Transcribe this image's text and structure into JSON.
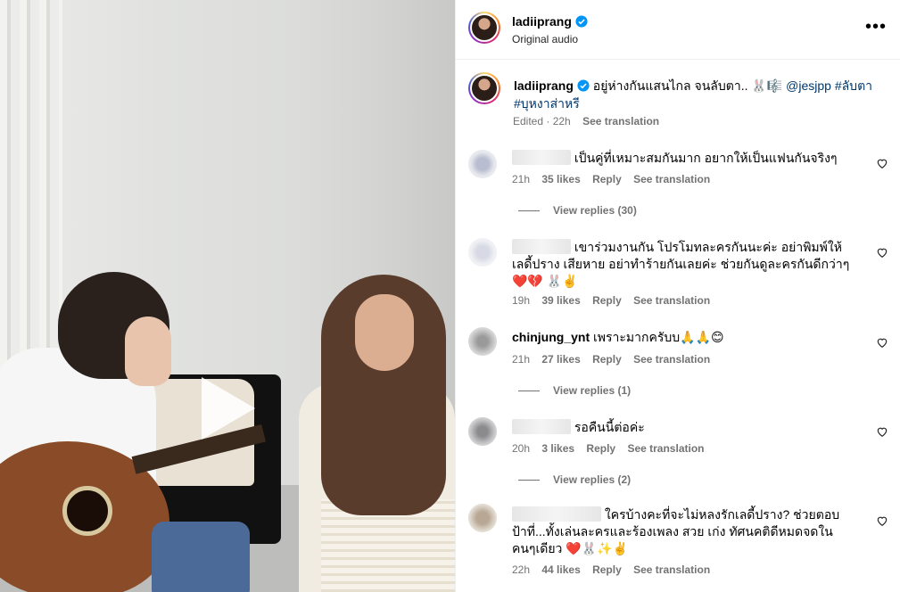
{
  "post": {
    "username": "ladiiprang",
    "audio": "Original audio"
  },
  "caption": {
    "username": "ladiiprang",
    "text": "อยู่ห่างกันแสนไกล จนลับตา.. 🐰🎼",
    "mention": "@jesjpp",
    "hashtag1": "#ลับตา",
    "hashtag2": "#บุหงาส่าหรี",
    "edited": "Edited",
    "time": "22h",
    "see_translation": "See translation"
  },
  "comments": [
    {
      "text": "เป็นคู่ที่เหมาะสมกันมาก อยากให้เป็นแฟนกันจริงๆ",
      "time": "21h",
      "likes": "35 likes",
      "reply": "Reply",
      "see_translation": "See translation",
      "view_replies": "View replies (30)"
    },
    {
      "text": "เขาร่วมงานกัน โปรโมทละครกันนะค่ะ อย่าพิมพ์ให้เลดี้ปราง เสียหาย อย่าทำร้ายกันเลยค่ะ ช่วยกันดูละครกันดีกว่าๆ ❤️💔 🐰✌️",
      "time": "19h",
      "likes": "39 likes",
      "reply": "Reply",
      "see_translation": "See translation"
    },
    {
      "username": "chinjung_ynt",
      "text": "เพราะมากครับบ🙏🙏😊",
      "time": "21h",
      "likes": "27 likes",
      "reply": "Reply",
      "see_translation": "See translation",
      "view_replies": "View replies (1)"
    },
    {
      "text": "รอคืนนี้ต่อค่ะ",
      "time": "20h",
      "likes": "3 likes",
      "reply": "Reply",
      "see_translation": "See translation",
      "view_replies": "View replies (2)"
    },
    {
      "text": "ใครบ้างคะที่จะไม่หลงรักเลดี้ปราง? ช่วยตอบป้าที่...ทั้งเล่นละครและร้องเพลง สวย เก่ง ทัศนคติดีหมดจดในคนๆเดียว ❤️🐰✨✌️",
      "time": "22h",
      "likes": "44 likes",
      "reply": "Reply",
      "see_translation": "See translation"
    }
  ],
  "colors": {
    "link": "#00376b",
    "meta": "#737373",
    "verified": "#0095f6"
  }
}
